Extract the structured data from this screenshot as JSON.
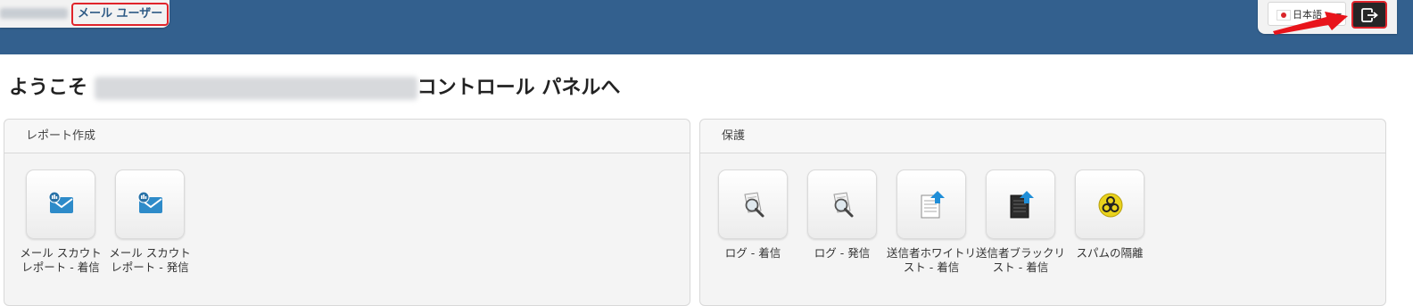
{
  "header": {
    "user_type": "メール ユーザー",
    "language": "日本語",
    "colors": {
      "bar": "#33608e",
      "highlight": "#e0242b"
    },
    "logout_icon": "logout-icon"
  },
  "welcome": {
    "prefix": "ようこそ ",
    "suffix": "コントロール パネルへ"
  },
  "reporting": {
    "title": "レポート作成",
    "items": [
      {
        "label": "メール スカウト レポート - 着信",
        "icon": "mail-report-icon"
      },
      {
        "label": "メール スカウト レポート - 発信",
        "icon": "mail-report-icon"
      }
    ]
  },
  "protection": {
    "title": "保護",
    "items": [
      {
        "label": "ログ - 着信",
        "icon": "log-search-icon"
      },
      {
        "label": "ログ - 発信",
        "icon": "log-search-icon"
      },
      {
        "label": "送信者ホワイトリスト - 着信",
        "icon": "whitelist-icon"
      },
      {
        "label": "送信者ブラックリスト - 着信",
        "icon": "blacklist-icon"
      },
      {
        "label": "スパムの隔離",
        "icon": "biohazard-icon"
      }
    ]
  }
}
